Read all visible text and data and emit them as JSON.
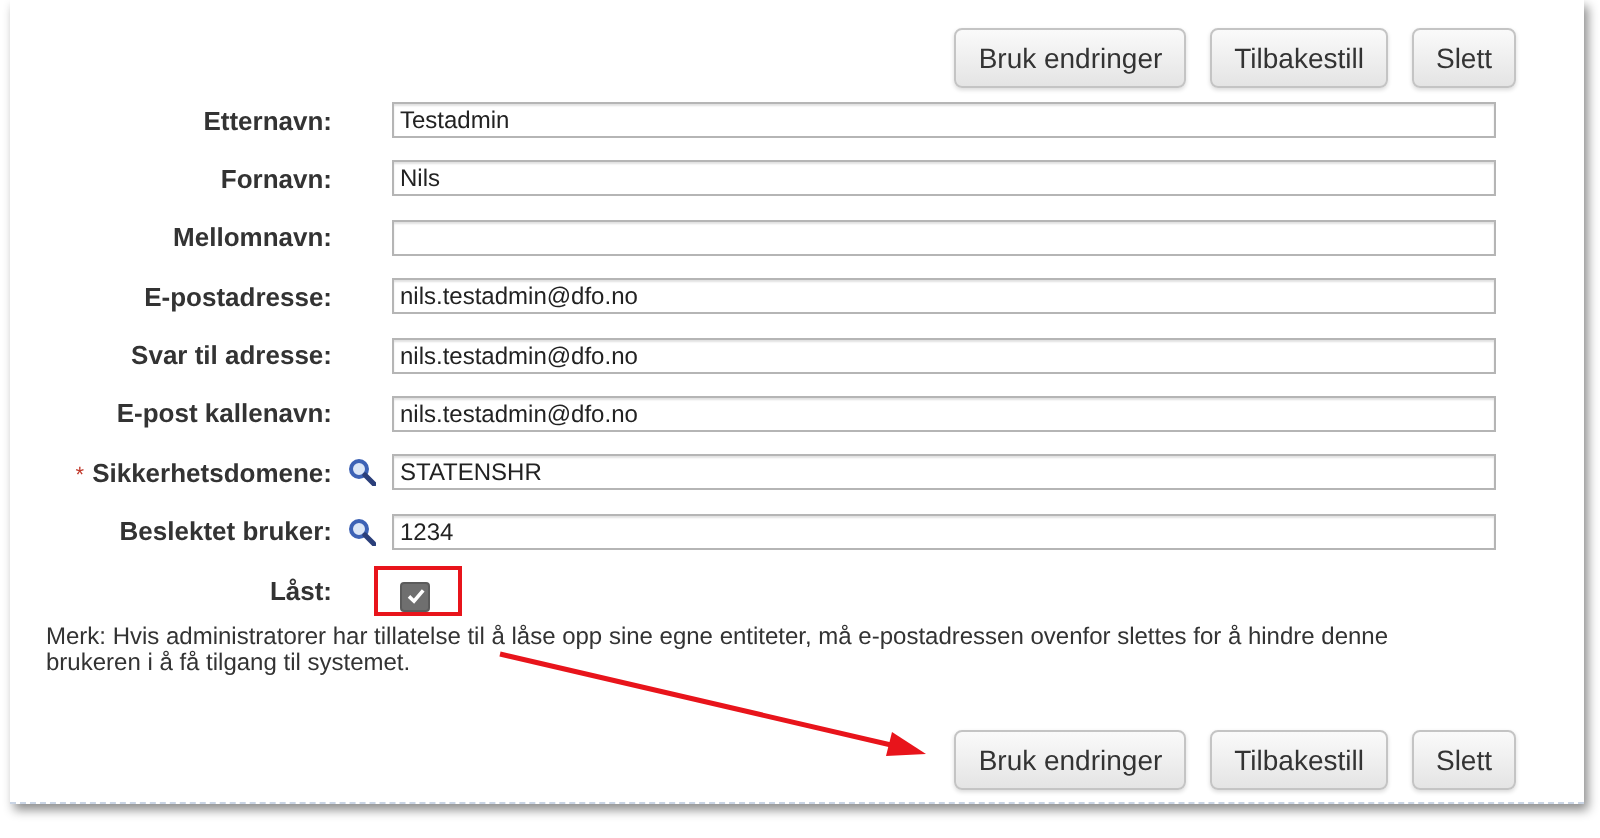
{
  "top_buttons": [
    "Bruk endringer",
    "Tilbakestill",
    "Slett"
  ],
  "fields": [
    {
      "kind": "text",
      "label": "Etternavn:",
      "value": "Testadmin",
      "lookup": false
    },
    {
      "kind": "text",
      "label": "Fornavn:",
      "value": "Nils",
      "lookup": false
    },
    {
      "kind": "text",
      "label": "Mellomnavn:",
      "lookup": false
    },
    {
      "kind": "text",
      "label": "E-postadresse:",
      "value": "nils.testadmin@dfo.no",
      "lookup": false
    },
    {
      "kind": "text",
      "label": "Svar til adresse:",
      "value": "nils.testadmin@dfo.no",
      "lookup": false
    },
    {
      "kind": "text",
      "label": "E-post kallenavn:",
      "value": "nils.testadmin@dfo.no",
      "lookup": false
    },
    {
      "kind": "text",
      "label": "Sikkerhetsdomene:",
      "required_mark": "*",
      "value": "STATENSHR",
      "lookup": true
    },
    {
      "kind": "text",
      "label": "Beslektet bruker:",
      "value": "1234",
      "lookup": true
    },
    {
      "kind": "checkbox",
      "label": "Låst:",
      "checked": true,
      "lookup": false
    }
  ],
  "note": "Merk: Hvis administratorer har tillatelse til å låse opp sine egne entiteter, må e-postadressen ovenfor slettes for å hindre denne brukeren i å få tilgang til systemet.",
  "bottom_buttons": [
    "Bruk endringer",
    "Tilbakestill",
    "Slett"
  ]
}
